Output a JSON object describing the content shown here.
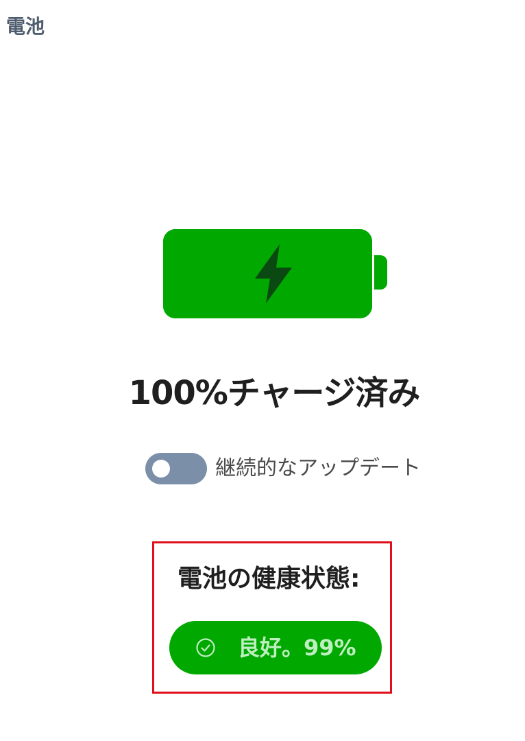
{
  "page": {
    "title": "電池"
  },
  "battery": {
    "level_percent": 100,
    "charging": true,
    "status_text": "100%チャージ済み",
    "color": "#00a800",
    "icon": "lightning-bolt-icon"
  },
  "continuous_update": {
    "label": "継続的なアップデート",
    "enabled": false
  },
  "health": {
    "heading": "電池の健康状態:",
    "status_icon": "check-circle-icon",
    "value_text": "良好。99%",
    "color": "#00a800",
    "highlight_color": "#e0101a"
  }
}
